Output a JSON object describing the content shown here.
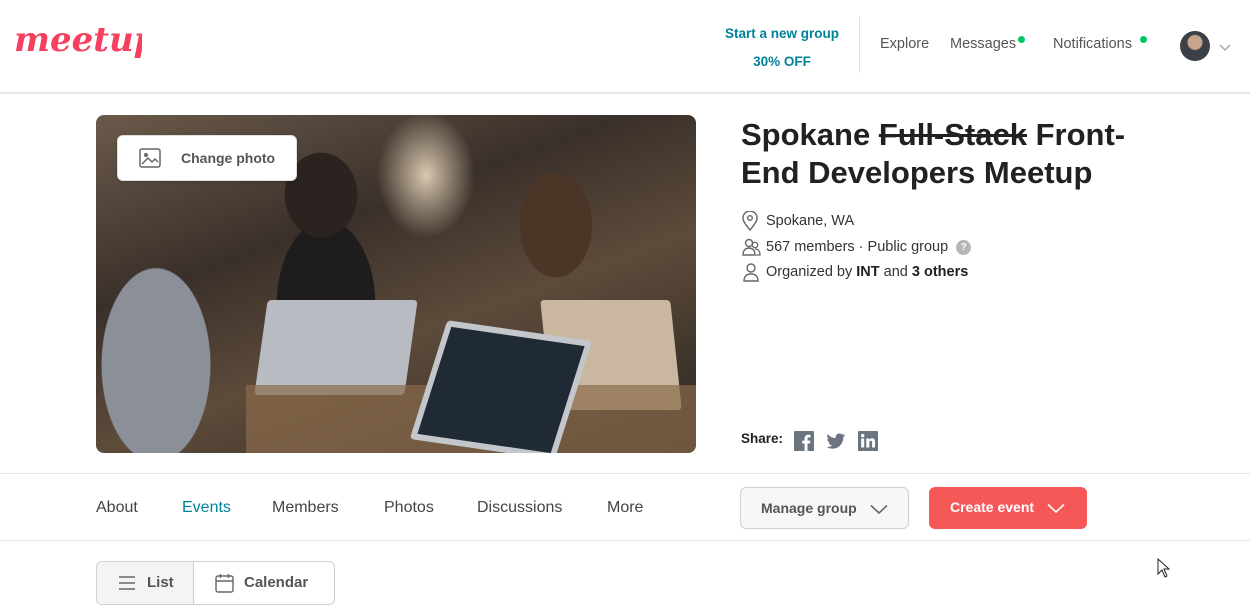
{
  "brand": {
    "logo_text": "meetup",
    "logo_color": "#f64060"
  },
  "header": {
    "promo_line1": "Start a new group",
    "promo_line2": "30% OFF",
    "nav": {
      "explore": "Explore",
      "messages": "Messages",
      "notifications": "Notifications"
    },
    "accent": "#00829b",
    "notification_dot_color": "#00c569"
  },
  "hero": {
    "change_photo_label": "Change photo",
    "title_part1": "Spokane ",
    "title_struck": "Full-Stack",
    "title_part2": " Front-End Developers Meetup",
    "location": "Spokane, WA",
    "members": "567 members",
    "separator": " · ",
    "group_type": "Public group",
    "help_glyph": "?",
    "organized_prefix": "Organized by ",
    "organizer": "INT",
    "organized_and": " and ",
    "others": "3 others",
    "share_label": "Share:"
  },
  "tabs": [
    {
      "label": "About",
      "active": false
    },
    {
      "label": "Events",
      "active": true
    },
    {
      "label": "Members",
      "active": false
    },
    {
      "label": "Photos",
      "active": false
    },
    {
      "label": "Discussions",
      "active": false
    },
    {
      "label": "More",
      "active": false
    }
  ],
  "actions": {
    "manage_group": "Manage group",
    "create_event": "Create event",
    "create_color": "#f65858"
  },
  "view_toggle": {
    "list": "List",
    "calendar": "Calendar",
    "selected": "List"
  }
}
